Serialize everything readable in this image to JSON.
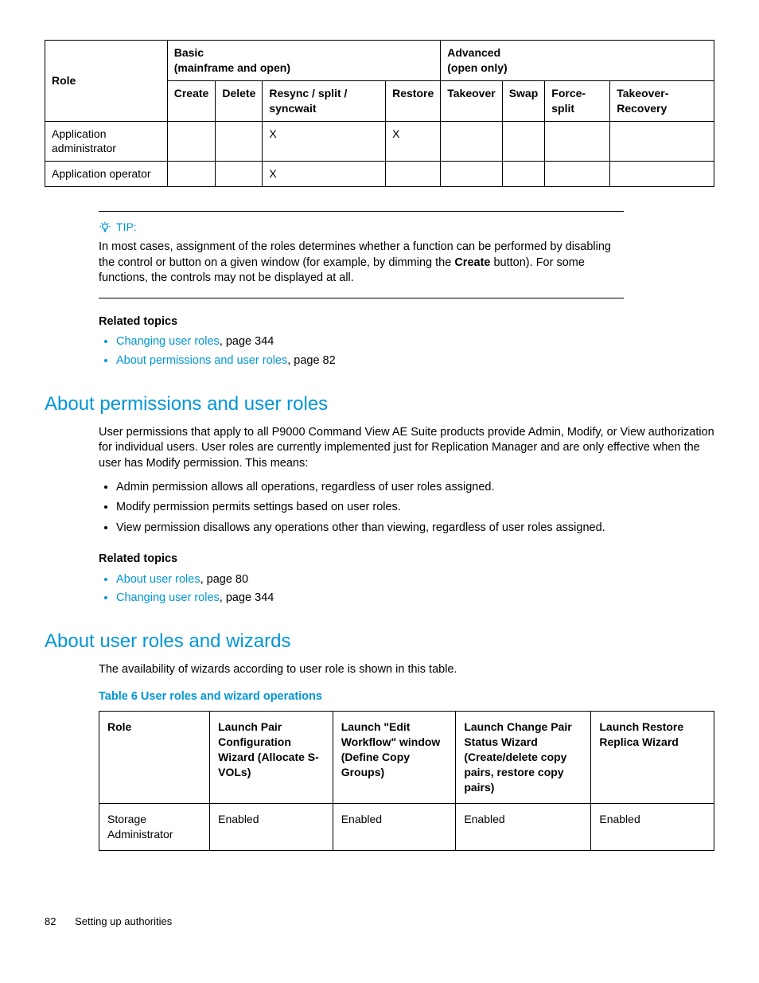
{
  "table1": {
    "header": {
      "role": "Role",
      "basic": "Basic\n(mainframe and open)",
      "advanced": "Advanced\n(open only)",
      "create": "Create",
      "delete": "Delete",
      "resync": "Resync / split / syncwait",
      "restore": "Restore",
      "takeover": "Takeover",
      "swap": "Swap",
      "forcesplit": "Force-split",
      "takeoverrec": "Takeover-Recovery"
    },
    "rows": [
      {
        "role": "Application administrator",
        "create": "",
        "delete": "",
        "resync": "X",
        "restore": "X",
        "takeover": "",
        "swap": "",
        "forcesplit": "",
        "takeoverrec": ""
      },
      {
        "role": "Application operator",
        "create": "",
        "delete": "",
        "resync": "X",
        "restore": "",
        "takeover": "",
        "swap": "",
        "forcesplit": "",
        "takeoverrec": ""
      }
    ]
  },
  "tip": {
    "label": "TIP:",
    "body_pre": "In most cases, assignment of the roles determines whether a function can be performed by disabling the control or button on a given window (for example, by dimming the ",
    "body_bold": "Create",
    "body_post": " button). For some functions, the controls may not be displayed at all."
  },
  "related1": {
    "heading": "Related topics",
    "items": [
      {
        "link": "Changing user roles",
        "suffix": ", page 344"
      },
      {
        "link": "About permissions and user roles",
        "suffix": ", page 82"
      }
    ]
  },
  "section1": {
    "title": "About permissions and user roles",
    "para": "User permissions that apply to all P9000 Command View AE Suite products provide Admin, Modify, or View authorization for individual users. User roles are currently implemented just for Replication Manager and are only effective when the user has Modify permission. This means:",
    "bullets": [
      "Admin permission allows all operations, regardless of user roles assigned.",
      "Modify permission permits settings based on user roles.",
      "View permission disallows any operations other than viewing, regardless of user roles assigned."
    ]
  },
  "related2": {
    "heading": "Related topics",
    "items": [
      {
        "link": "About user roles",
        "suffix": ", page 80"
      },
      {
        "link": "Changing user roles",
        "suffix": ", page 344"
      }
    ]
  },
  "section2": {
    "title": "About user roles and wizards",
    "para": "The availability of wizards according to user role is shown in this table.",
    "caption": "Table 6 User roles and wizard operations"
  },
  "table2": {
    "header": {
      "role": "Role",
      "c1": "Launch Pair Configuration Wizard (Allocate S-VOLs)",
      "c2": "Launch \"Edit Workflow\" window (Define Copy Groups)",
      "c3": "Launch Change Pair Status Wizard (Create/delete copy pairs, restore copy pairs)",
      "c4": "Launch Restore Replica Wizard"
    },
    "rows": [
      {
        "role": "Storage Administrator",
        "c1": "Enabled",
        "c2": "Enabled",
        "c3": "Enabled",
        "c4": "Enabled"
      }
    ]
  },
  "footer": {
    "page": "82",
    "title": "Setting up authorities"
  }
}
